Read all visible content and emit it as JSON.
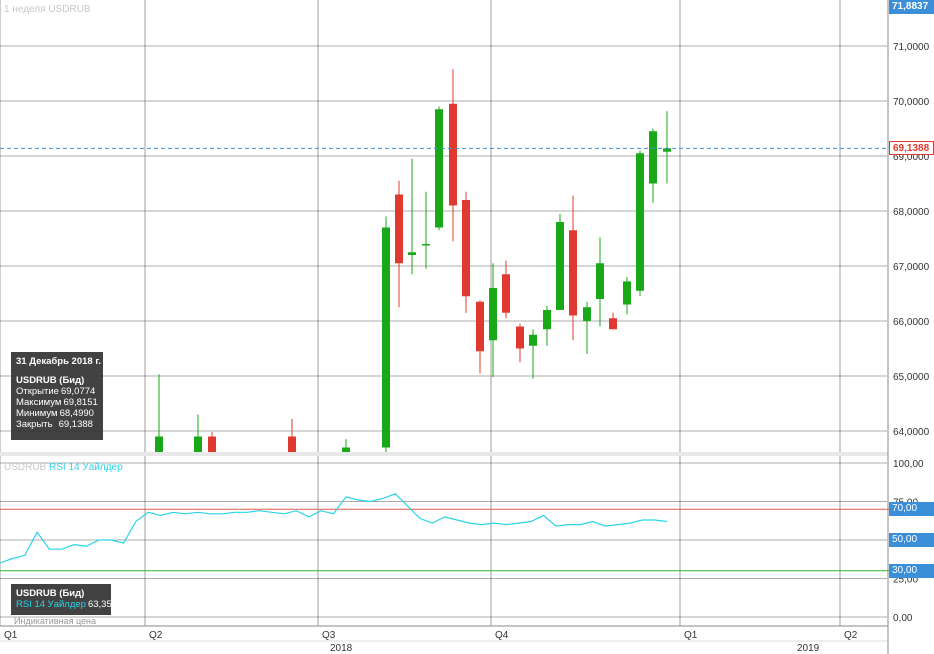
{
  "header": {
    "timeframe_label": "1 неделя",
    "symbol": "USDRUB"
  },
  "price_axis": {
    "ticks": [
      "71,0000",
      "70,0000",
      "69,0000",
      "68,0000",
      "67,0000",
      "66,0000",
      "65,0000",
      "64,0000"
    ],
    "top_label": "71,8837",
    "current_price": "69,1388"
  },
  "rsi_axis": {
    "ticks": [
      "100,00",
      "75,00",
      "50,00",
      "25,00",
      "0,00"
    ],
    "level_high": "70,00",
    "level_mid": "50,00",
    "level_low": "30,00"
  },
  "rsi_header": {
    "symbol": "USDRUB",
    "name": "RSI 14 Уайлдер"
  },
  "time_axis": {
    "quarters": [
      "Q1",
      "Q2",
      "Q3",
      "Q4",
      "Q1",
      "Q2"
    ],
    "years": [
      "2018",
      "2019"
    ]
  },
  "tooltip": {
    "date": "31 Декабрь 2018 г.",
    "title": "USDRUB (Бид)",
    "open_label": "Открытие",
    "open": "69,0774",
    "high_label": "Максимум",
    "high": "69,8151",
    "low_label": "Минимум",
    "low": "68,4990",
    "close_label": "Закрыть",
    "close": "69,1388"
  },
  "rsi_tooltip": {
    "title": "USDRUB (Бид)",
    "name": "RSI 14 Уайлдер",
    "value": "63,35"
  },
  "indicative_label": "Индикативная цена",
  "colors": {
    "up": "#18a818",
    "down": "#e0392f",
    "rsi_line": "#2ad4e8",
    "level_high": "#e05a4a",
    "level_low": "#2bb82b",
    "price_tag": "#e0392f",
    "rsi_tag": "#3a8fd8"
  },
  "chart_data": [
    {
      "type": "candlestick",
      "series_name": "USDRUB",
      "ylim": [
        63.8,
        71.8837
      ],
      "candles": [
        {
          "o": 63.5,
          "h": 65.03,
          "l": 62.5,
          "c": 63.9
        },
        {
          "o": 63.6,
          "h": 64.3,
          "l": 63.2,
          "c": 63.9
        },
        {
          "o": 63.9,
          "h": 63.98,
          "l": 63.1,
          "c": 63.4
        },
        {
          "o": 63.9,
          "h": 64.22,
          "l": 63.2,
          "c": 63.5
        },
        {
          "o": 63.6,
          "h": 63.85,
          "l": 63.4,
          "c": 63.7
        },
        {
          "o": 63.7,
          "h": 67.9,
          "l": 63.6,
          "c": 67.7
        },
        {
          "o": 68.3,
          "h": 68.55,
          "l": 66.25,
          "c": 67.05
        },
        {
          "o": 67.2,
          "h": 68.95,
          "l": 66.85,
          "c": 67.25
        },
        {
          "o": 67.4,
          "h": 68.35,
          "l": 66.95,
          "c": 67.4
        },
        {
          "o": 67.7,
          "h": 69.9,
          "l": 67.65,
          "c": 69.85
        },
        {
          "o": 69.95,
          "h": 70.58,
          "l": 67.45,
          "c": 68.1
        },
        {
          "o": 68.2,
          "h": 68.35,
          "l": 66.15,
          "c": 66.45
        },
        {
          "o": 66.35,
          "h": 66.38,
          "l": 65.05,
          "c": 65.45
        },
        {
          "o": 65.65,
          "h": 67.05,
          "l": 64.98,
          "c": 66.6
        },
        {
          "o": 66.85,
          "h": 67.1,
          "l": 66.05,
          "c": 66.15
        },
        {
          "o": 65.9,
          "h": 65.95,
          "l": 65.25,
          "c": 65.5
        },
        {
          "o": 65.55,
          "h": 65.85,
          "l": 64.95,
          "c": 65.75
        },
        {
          "o": 65.85,
          "h": 66.28,
          "l": 65.55,
          "c": 66.2
        },
        {
          "o": 66.2,
          "h": 67.95,
          "l": 66.2,
          "c": 67.8
        },
        {
          "o": 67.65,
          "h": 68.28,
          "l": 65.65,
          "c": 66.1
        },
        {
          "o": 66.0,
          "h": 66.35,
          "l": 65.4,
          "c": 66.25
        },
        {
          "o": 66.4,
          "h": 67.52,
          "l": 65.9,
          "c": 67.05
        },
        {
          "o": 66.05,
          "h": 66.15,
          "l": 65.9,
          "c": 65.85
        },
        {
          "o": 66.3,
          "h": 66.8,
          "l": 66.12,
          "c": 66.72
        },
        {
          "o": 66.55,
          "h": 69.1,
          "l": 66.45,
          "c": 69.05
        },
        {
          "o": 68.5,
          "h": 69.5,
          "l": 68.15,
          "c": 69.45
        },
        {
          "o": 69.0774,
          "h": 69.8151,
          "l": 68.499,
          "c": 69.1388
        }
      ],
      "last_close": 69.1388
    },
    {
      "type": "line",
      "series_name": "RSI 14 Уайлдер",
      "ylim": [
        0,
        100
      ],
      "values": [
        35,
        38,
        40,
        55,
        44,
        44,
        47,
        46,
        50,
        50,
        48,
        62,
        68,
        66,
        68,
        67,
        68,
        67,
        67,
        68,
        68,
        69,
        68,
        67,
        69,
        65,
        69,
        67,
        78,
        76,
        75,
        77,
        80,
        72,
        64,
        61,
        65,
        63,
        61,
        60,
        61,
        60,
        61,
        62,
        66,
        59,
        60,
        60,
        62,
        59,
        60,
        61,
        63,
        63,
        62
      ],
      "levels": [
        70,
        50,
        30
      ],
      "last_value": 63.35
    }
  ]
}
